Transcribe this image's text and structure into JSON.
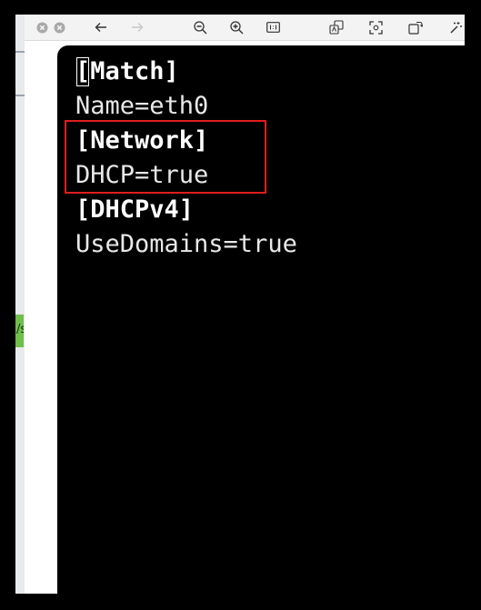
{
  "toolbar": {
    "icons": [
      "close-circle-icon",
      "minimize-circle-icon",
      "back-arrow-icon",
      "forward-arrow-icon",
      "zoom-out-icon",
      "zoom-in-icon",
      "actual-size-icon",
      "translate-icon",
      "fit-screen-icon",
      "rotate-icon",
      "magic-wand-icon"
    ]
  },
  "side": {
    "green_tab_text": "/s"
  },
  "terminal": {
    "lines": [
      {
        "text": "[Match]",
        "bold": true
      },
      {
        "text": "Name=eth0",
        "bold": false
      },
      {
        "text": "[Network]",
        "bold": true
      },
      {
        "text": "DHCP=true",
        "bold": false
      },
      {
        "text": "[DHCPv4]",
        "bold": true
      },
      {
        "text": "UseDomains=true",
        "bold": false
      }
    ]
  },
  "colors": {
    "highlight": "#e01e1e",
    "terminal_bg": "#000000",
    "terminal_fg": "#ffffff",
    "side_tab": "#6fbf4a"
  }
}
